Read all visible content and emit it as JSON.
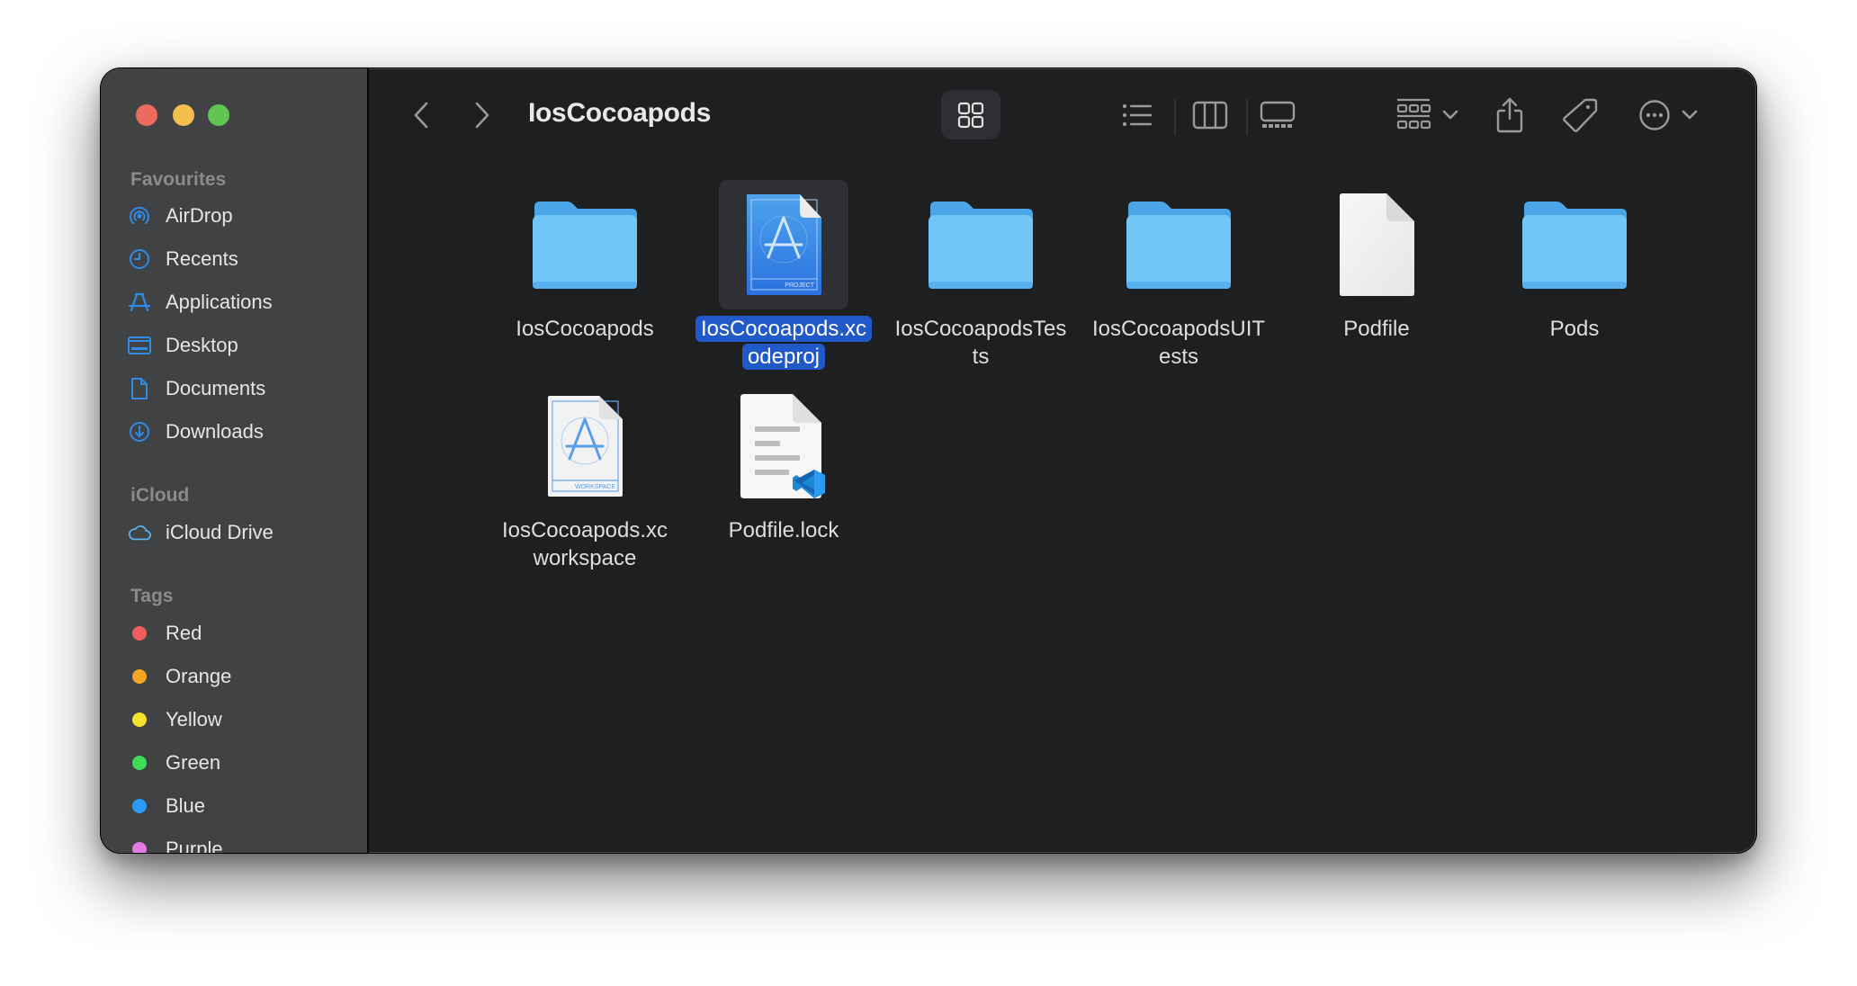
{
  "window": {
    "title": "IosCocoapods",
    "traffic_lights": [
      "close",
      "minimize",
      "zoom"
    ]
  },
  "sidebar": {
    "sections": [
      {
        "header": "Favourites",
        "items": [
          {
            "label": "AirDrop",
            "icon": "airdrop-icon"
          },
          {
            "label": "Recents",
            "icon": "clock-icon"
          },
          {
            "label": "Applications",
            "icon": "applications-icon"
          },
          {
            "label": "Desktop",
            "icon": "desktop-icon"
          },
          {
            "label": "Documents",
            "icon": "document-icon"
          },
          {
            "label": "Downloads",
            "icon": "download-icon"
          }
        ]
      },
      {
        "header": "iCloud",
        "items": [
          {
            "label": "iCloud Drive",
            "icon": "cloud-icon"
          }
        ]
      },
      {
        "header": "Tags",
        "items": [
          {
            "label": "Red",
            "color": "#ee5f5b"
          },
          {
            "label": "Orange",
            "color": "#f5a623"
          },
          {
            "label": "Yellow",
            "color": "#f7e12a"
          },
          {
            "label": "Green",
            "color": "#3ddc58"
          },
          {
            "label": "Blue",
            "color": "#2c9bf7"
          },
          {
            "label": "Purple",
            "color": "#e37be8"
          }
        ]
      }
    ],
    "accent": "#2f8ae8"
  },
  "toolbar": {
    "back_icon": "chevron-left-icon",
    "forward_icon": "chevron-right-icon",
    "views": [
      "icon-view",
      "list-view",
      "column-view",
      "gallery-view"
    ],
    "selected_view": "icon-view",
    "group_icon": "group-icon",
    "share_icon": "share-icon",
    "tag_icon": "tag-icon",
    "more_icon": "more-icon",
    "search_icon": "search-icon"
  },
  "files": [
    {
      "name": "IosCocoapods",
      "type": "folder",
      "selected": false
    },
    {
      "name": "IosCocoapods.xcodeproj",
      "type": "xcodeproj",
      "selected": true,
      "lines": [
        "IosCocoapods.xc",
        "odeproj"
      ],
      "badge": "PROJECT"
    },
    {
      "name": "IosCocoapodsTests",
      "type": "folder",
      "selected": false,
      "lines": [
        "IosCocoapodsTes",
        "ts"
      ]
    },
    {
      "name": "IosCocoapodsUITests",
      "type": "folder",
      "selected": false,
      "lines": [
        "IosCocoapodsUIT",
        "ests"
      ]
    },
    {
      "name": "Podfile",
      "type": "document",
      "selected": false
    },
    {
      "name": "Pods",
      "type": "folder",
      "selected": false
    },
    {
      "name": "IosCocoapods.xcworkspace",
      "type": "xcworkspace",
      "selected": false,
      "lines": [
        "IosCocoapods.xc",
        "workspace"
      ],
      "badge": "WORKSPACE"
    },
    {
      "name": "Podfile.lock",
      "type": "vscode-document",
      "selected": false
    }
  ],
  "colors": {
    "selection": "#2159c9",
    "folder": "#6ec3f7",
    "content_bg": "#1e1f21",
    "sidebar_bg": "#414243"
  }
}
